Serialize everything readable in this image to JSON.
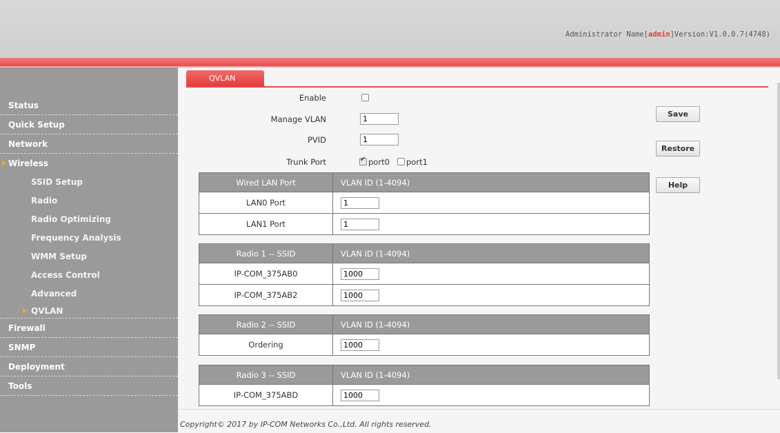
{
  "header": {
    "admin_prefix": "Administrator Name[",
    "admin_name": "admin",
    "admin_suffix": "]",
    "version": "Version:V1.0.0.7(4748)"
  },
  "sidebar": {
    "items": [
      {
        "label": "Status"
      },
      {
        "label": "Quick Setup"
      },
      {
        "label": "Network"
      },
      {
        "label": "Wireless"
      },
      {
        "label": "SSID Setup"
      },
      {
        "label": "Radio"
      },
      {
        "label": "Radio Optimizing"
      },
      {
        "label": "Frequency Analysis"
      },
      {
        "label": "WMM Setup"
      },
      {
        "label": "Access Control"
      },
      {
        "label": "Advanced"
      },
      {
        "label": "QVLAN"
      },
      {
        "label": "Firewall"
      },
      {
        "label": "SNMP"
      },
      {
        "label": "Deployment"
      },
      {
        "label": "Tools"
      }
    ],
    "active_section": "Wireless",
    "active_item": "QVLAN"
  },
  "tab": {
    "label": "QVLAN"
  },
  "form": {
    "enable_label": "Enable",
    "enable_checked": false,
    "manage_vlan_label": "Manage VLAN",
    "manage_vlan_value": "1",
    "pvid_label": "PVID",
    "pvid_value": "1",
    "trunk_port_label": "Trunk Port",
    "trunk_ports": [
      {
        "label": "port0",
        "checked": true
      },
      {
        "label": "port1",
        "checked": false
      }
    ]
  },
  "buttons": {
    "save": "Save",
    "restore": "Restore",
    "help": "Help"
  },
  "tables": [
    {
      "header": [
        "Wired LAN Port",
        "VLAN ID (1-4094)"
      ],
      "rows": [
        {
          "label": "LAN0 Port",
          "value": "1"
        },
        {
          "label": "LAN1 Port",
          "value": "1"
        }
      ]
    },
    {
      "header": [
        "Radio 1 -- SSID",
        "VLAN ID (1-4094)"
      ],
      "rows": [
        {
          "label": "IP-COM_375AB0",
          "value": "1000"
        },
        {
          "label": "IP-COM_375AB2",
          "value": "1000"
        }
      ]
    },
    {
      "header": [
        "Radio 2 -- SSID",
        "VLAN ID (1-4094)"
      ],
      "rows": [
        {
          "label": "Ordering",
          "value": "1000"
        }
      ]
    },
    {
      "header": [
        "Radio 3 -- SSID",
        "VLAN ID (1-4094)"
      ],
      "rows": [
        {
          "label": "IP-COM_375ABD",
          "value": "1000"
        }
      ]
    }
  ],
  "footer": {
    "copyright": "Copyright© 2017 by IP-COM Networks Co.,Ltd. All rights reserved."
  },
  "colors": {
    "accent": "#e84b4b",
    "sidebar": "#9a9a9a",
    "arrow": "#f5a623"
  }
}
